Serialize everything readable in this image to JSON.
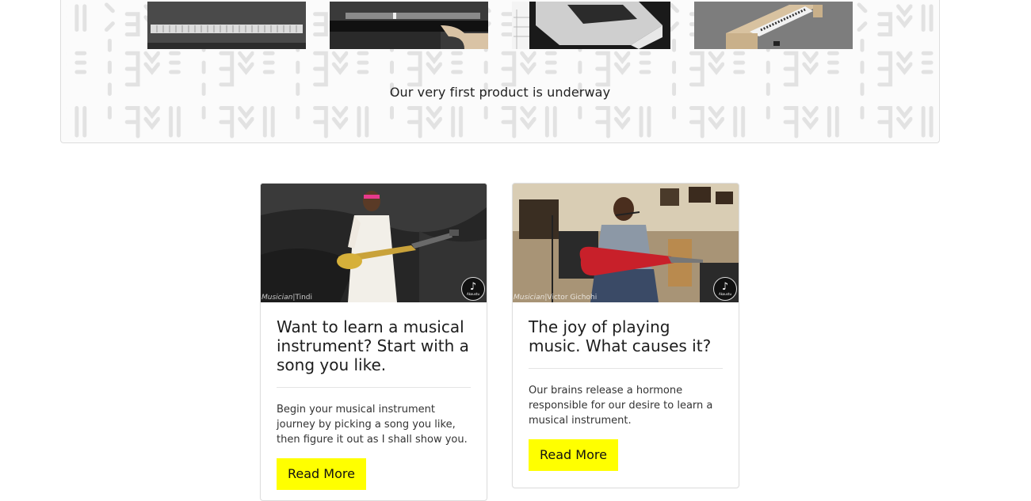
{
  "banner": {
    "caption": "Our very first product is underway",
    "thumbnails": [
      {
        "alt": "product-render-keyboard-front"
      },
      {
        "alt": "product-render-keyboard-side"
      },
      {
        "alt": "product-render-keyboard-angle"
      },
      {
        "alt": "product-render-keyboard-wood"
      }
    ]
  },
  "cards": [
    {
      "credit_role": "Musician",
      "credit_name": "Tindi",
      "logo_text": "Akoustu",
      "title": "Want to learn a musical instrument? Start with a song you like.",
      "text": "Begin your musical instrument journey by picking a song you like, then figure it out as I shall show you.",
      "button": "Read More"
    },
    {
      "credit_role": "Musician",
      "credit_name": "Victor Gichohi",
      "logo_text": "Akoustu",
      "title": "The joy of playing music. What causes it?",
      "text": "Our brains release a hormone responsible for our desire to learn a musical instrument.",
      "button": "Read More"
    }
  ],
  "colors": {
    "button": "#ffff00",
    "border": "#dddddd",
    "pattern": "#e4e4e4"
  }
}
